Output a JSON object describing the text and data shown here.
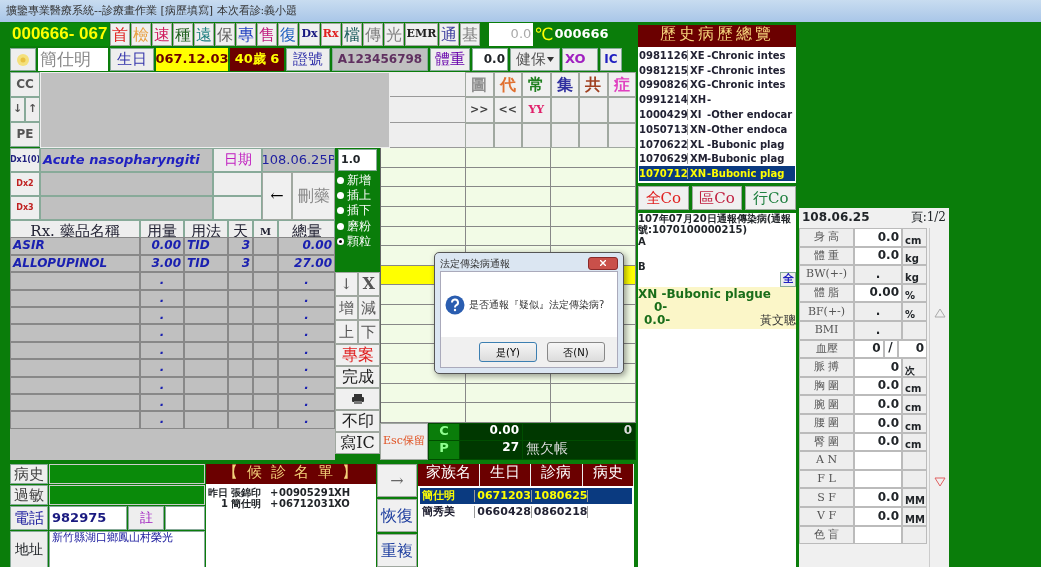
{
  "window": {
    "title": "擴鑒專業醫療系統--診療畫作業 [病歷填寫]  本次看診:義小題"
  },
  "toolbar": {
    "chart_no": "000666- 067",
    "buttons": [
      {
        "label": "首",
        "color": "#e02020"
      },
      {
        "label": "檢",
        "color": "#e8a040"
      },
      {
        "label": "速",
        "color": "#d02060"
      },
      {
        "label": "種",
        "color": "#206020"
      },
      {
        "label": "遠",
        "color": "#208080"
      },
      {
        "label": "保",
        "color": "#606060"
      },
      {
        "label": "專",
        "color": "#2040c0"
      },
      {
        "label": "售",
        "color": "#c02080"
      },
      {
        "label": "復",
        "color": "#2060c0"
      },
      {
        "label": "Dx",
        "color": "#1a1a80"
      },
      {
        "label": "Rx",
        "color": "#e02020"
      },
      {
        "label": "檔",
        "color": "#206060"
      },
      {
        "label": "傳",
        "color": "#808080"
      },
      {
        "label": "光",
        "color": "#808080"
      },
      {
        "label": "EMR",
        "color": "#202020"
      },
      {
        "label": "通",
        "color": "#4040a0"
      },
      {
        "label": "基",
        "color": "#808080"
      }
    ],
    "temperature": "0.0",
    "temperature_unit": "℃",
    "patient_no": "000666"
  },
  "patient": {
    "name": "簡仕明",
    "birth_label": "生日",
    "birth": "067.12.03",
    "age": "40歲 6",
    "id_label": "證號",
    "id_no": "A123456798",
    "weight_label": "體重",
    "weight": "0.0",
    "insurance": "健保",
    "insurance_code": "XO",
    "card": "IC"
  },
  "note_buttons": [
    {
      "label": "CC",
      "kind": "wide"
    },
    {
      "label": "↓",
      "kind": "half"
    },
    {
      "label": "↑",
      "kind": "half"
    },
    {
      "label": "PE",
      "kind": "wide"
    }
  ],
  "quick_grid": [
    [
      {
        "label": "圖",
        "color": "#909090"
      },
      {
        "label": "代",
        "color": "#e07030"
      },
      {
        "label": "常",
        "color": "#208020"
      },
      {
        "label": "集",
        "color": "#3030a0"
      },
      {
        "label": "共",
        "color": "#a04020"
      },
      {
        "label": "症",
        "color": "#e040c0"
      }
    ],
    [
      {
        "label": ">>",
        "color": "#404040"
      },
      {
        "label": "<<",
        "color": "#404040"
      },
      {
        "label": "YY",
        "color": "#e0206a"
      }
    ]
  ],
  "diagnoses": [
    {
      "code": "Dx1(0)",
      "text": "Acute nasopharyngiti"
    },
    {
      "code": "Dx2"
    },
    {
      "code": "Dx3"
    }
  ],
  "date_label": "日期",
  "date": "108.06.25P",
  "dose_factor": "1.0",
  "back_button": "←",
  "delete_button": "刪藥",
  "insert_modes": [
    {
      "label": "新增",
      "selected": false
    },
    {
      "label": "插上",
      "selected": false
    },
    {
      "label": "插下",
      "selected": false
    },
    {
      "label": "磨粉",
      "selected": false
    },
    {
      "label": "顆粒",
      "selected": true
    }
  ],
  "side_buttons": [
    {
      "kind": "pair",
      "labels": [
        "↓",
        "X"
      ]
    },
    {
      "kind": "pair",
      "labels": [
        "增",
        "減"
      ]
    },
    {
      "kind": "pair",
      "labels": [
        "上",
        "下"
      ]
    },
    {
      "kind": "text",
      "label": "專案",
      "color": "#e02020"
    },
    {
      "kind": "text",
      "label": "完成",
      "color": "#202020"
    },
    {
      "kind": "printer"
    },
    {
      "kind": "text",
      "label": "不印",
      "color": "#202020"
    },
    {
      "kind": "text",
      "label": "寫IC",
      "color": "#202020"
    }
  ],
  "rx": {
    "columns": [
      "Rx. 藥品名稱",
      "用量",
      "用法",
      "天",
      "M",
      "總量"
    ],
    "rows": [
      {
        "name": "ASIR",
        "dose": "0.00",
        "usage": "TID",
        "days": "3",
        "total": "0.00"
      },
      {
        "name": "ALLOPUPINOL",
        "dose": "3.00",
        "usage": "TID",
        "days": "3",
        "total": "27.00"
      },
      {
        "dose": ".",
        "total": "."
      },
      {
        "dose": ".",
        "total": "."
      },
      {
        "dose": ".",
        "total": "."
      },
      {
        "dose": ".",
        "total": "."
      },
      {
        "dose": ".",
        "total": "."
      },
      {
        "dose": ".",
        "total": "."
      },
      {
        "dose": ".",
        "total": "."
      },
      {
        "dose": ".",
        "total": "."
      },
      {
        "dose": ".",
        "total": "."
      }
    ]
  },
  "order_grid": {
    "rows": [
      {
        "selected": false
      },
      {
        "selected": false
      },
      {
        "selected": false
      },
      {
        "selected": false
      },
      {
        "selected": false
      },
      {
        "selected": false
      },
      {
        "selected": true
      },
      {
        "selected": false
      },
      {
        "selected": false
      },
      {
        "selected": false
      },
      {
        "selected": false
      },
      {
        "selected": false
      },
      {
        "selected": false
      },
      {
        "selected": false
      }
    ]
  },
  "billing": {
    "save_button": "Esc保留",
    "c_label": "C",
    "c_value": "0.00",
    "c_extra": "0",
    "p_label": "P",
    "p_value": "27",
    "p_extra": "無欠帳"
  },
  "profile": {
    "history_label": "病史",
    "allergy_label": "過敏",
    "phone_label": "電話",
    "phone": "982975",
    "note_button": "註",
    "address_label": "地址",
    "address": "新竹縣湖口鄉鳳山村榮光"
  },
  "waiting_list": {
    "title": "【 候 診 名 單 】",
    "rows": [
      {
        "no": "昨日",
        "name": "張錦印",
        "mark": "+",
        "code": "00905291",
        "dx": "XH"
      },
      {
        "no": "1",
        "name": "簡仕明",
        "mark": "+",
        "code": "06712031",
        "dx": "XO"
      }
    ]
  },
  "list_buttons": [
    "→",
    "恢復",
    "重複"
  ],
  "family": {
    "columns": [
      "家族名",
      "生日",
      "診病",
      "病史"
    ],
    "rows": [
      {
        "name": "簡仕明",
        "birth": "0671203",
        "visit": "1080625",
        "selected": true
      },
      {
        "name": "簡秀美",
        "birth": "0660428",
        "visit": "0860218",
        "selected": false
      }
    ]
  },
  "history": {
    "title": "歷史病歷總覽",
    "items": [
      {
        "date": "0981126",
        "code": "XE",
        "text": "-Chronic intes",
        "selected": false
      },
      {
        "date": "0981215",
        "code": "XF",
        "text": "-Chronic intes",
        "selected": false
      },
      {
        "date": "0990826",
        "code": "XG",
        "text": "-Chronic intes",
        "selected": false
      },
      {
        "date": "0991214",
        "code": "XH",
        "text": "-",
        "selected": false
      },
      {
        "date": "1000429",
        "code": "XI",
        "text": "-Other endocar",
        "selected": false
      },
      {
        "date": "1050713",
        "code": "XN",
        "text": "-Other endoca",
        "selected": false
      },
      {
        "date": "1070622",
        "code": "XL",
        "text": "-Bubonic plag",
        "selected": false
      },
      {
        "date": "1070629",
        "code": "XM",
        "text": "-Bubonic plag",
        "selected": false
      },
      {
        "date": "1070712",
        "code": "XN",
        "text": "-Bubonic plag",
        "selected": true
      }
    ],
    "copy_buttons": [
      {
        "label": "全Co",
        "color": "#e02020"
      },
      {
        "label": "區Co",
        "color": "#c02040"
      },
      {
        "label": "行Co",
        "color": "#208040"
      }
    ],
    "note": "107年07月20日通報傳染病(通報號:1070100000215)",
    "line_a": "A",
    "line_b": "B",
    "all_button": "全",
    "summary": {
      "title": "XN  -Bubonic plague",
      "line_1": "0-",
      "line_2": "0.0-",
      "doctor": "黃文聰"
    }
  },
  "vitals": {
    "date": "108.06.25",
    "page": "頁:1/2",
    "rows": [
      {
        "label": "身 高",
        "value": "0.0",
        "unit": "cm",
        "kind": "field"
      },
      {
        "label": "體 重",
        "value": "0.0",
        "unit": "kg",
        "kind": "field"
      },
      {
        "label": "BW(+-)",
        "value": ".",
        "unit": "kg",
        "kind": "calc"
      },
      {
        "label": "體 脂",
        "value": "0.00",
        "unit": "%",
        "kind": "field"
      },
      {
        "label": "BF(+-)",
        "value": ".",
        "unit": "%",
        "kind": "calc"
      },
      {
        "label": "BMI",
        "value": ".",
        "kind": "calc"
      },
      {
        "label": "血壓",
        "value": "0",
        "separator": "/",
        "value_2": "0",
        "kind": "pressure"
      },
      {
        "label": "脈 搏",
        "value": "0",
        "unit": "次",
        "kind": "field"
      },
      {
        "label": "胸 圍",
        "value": "0.0",
        "unit": "cm",
        "kind": "field"
      },
      {
        "label": "腕 圍",
        "value": "0.0",
        "unit": "cm",
        "kind": "field"
      },
      {
        "label": "腰 圍",
        "value": "0.0",
        "unit": "cm",
        "kind": "field"
      },
      {
        "label": "臀 圍",
        "value": "0.0",
        "unit": "cm",
        "kind": "field"
      },
      {
        "label": "A N",
        "kind": "field"
      },
      {
        "label": "F L",
        "kind": "field"
      },
      {
        "label": "S F",
        "value": "0.0",
        "unit": "MM",
        "kind": "field"
      },
      {
        "label": "V F",
        "value": "0.0",
        "unit": "MM",
        "kind": "field"
      },
      {
        "label": "色 盲",
        "kind": "field"
      }
    ]
  },
  "dialog": {
    "title": "法定傳染病通報",
    "message": "是否通報『疑似』法定傳染病?",
    "buttons": [
      "是(Y)",
      "否(N)"
    ]
  }
}
